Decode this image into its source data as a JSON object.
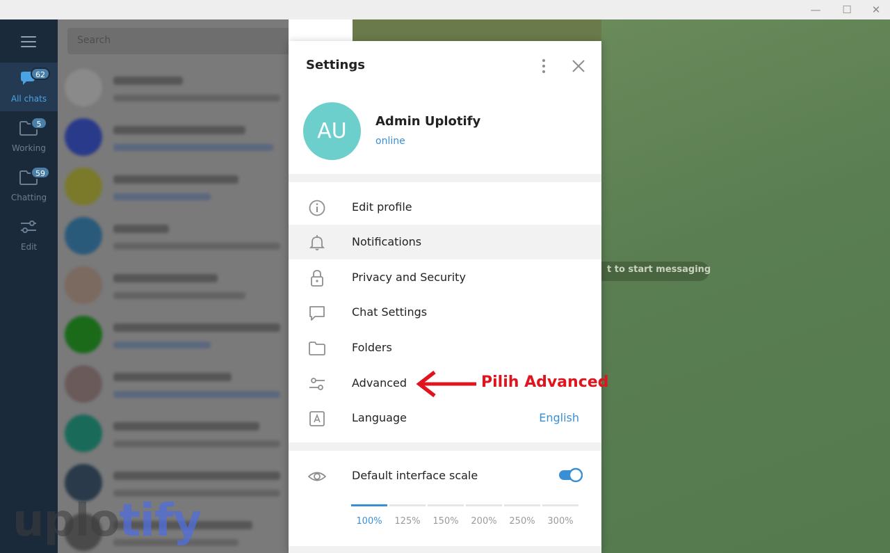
{
  "window": {
    "minimize_glyph": "—",
    "maximize_glyph": "☐",
    "close_glyph": "✕"
  },
  "rail": {
    "items": [
      {
        "label": "All chats",
        "badge": "62",
        "icon": "chat-bubbles-icon",
        "active": true
      },
      {
        "label": "Working",
        "badge": "5",
        "icon": "folder-icon",
        "active": false
      },
      {
        "label": "Chatting",
        "badge": "59",
        "icon": "folder-icon",
        "active": false
      },
      {
        "label": "Edit",
        "badge": "",
        "icon": "sliders-icon",
        "active": false
      }
    ]
  },
  "chatlist": {
    "search_placeholder": "Search"
  },
  "chat_area": {
    "empty_hint": "t to start messaging"
  },
  "settings": {
    "title": "Settings",
    "profile": {
      "initials": "AU",
      "name": "Admin Uplotify",
      "status": "online"
    },
    "menu": [
      {
        "label": "Edit profile",
        "icon": "info-icon"
      },
      {
        "label": "Notifications",
        "icon": "bell-icon"
      },
      {
        "label": "Privacy and Security",
        "icon": "lock-icon"
      },
      {
        "label": "Chat Settings",
        "icon": "chat-icon"
      },
      {
        "label": "Folders",
        "icon": "folder-icon"
      },
      {
        "label": "Advanced",
        "icon": "sliders-icon"
      },
      {
        "label": "Language",
        "icon": "language-icon",
        "value": "English"
      }
    ],
    "scale": {
      "label": "Default interface scale",
      "toggle_on": true,
      "options": [
        "100%",
        "125%",
        "150%",
        "200%",
        "250%",
        "300%"
      ],
      "selected": "100%"
    }
  },
  "annotation": {
    "text": "Pilih Advanced",
    "color": "#e0141e"
  },
  "watermark": {
    "part1": "uplo",
    "part2": "tify"
  },
  "colors": {
    "accent": "#3a8fd4",
    "rail": "#1b2a3a",
    "avatar": "#6ccfcb"
  }
}
